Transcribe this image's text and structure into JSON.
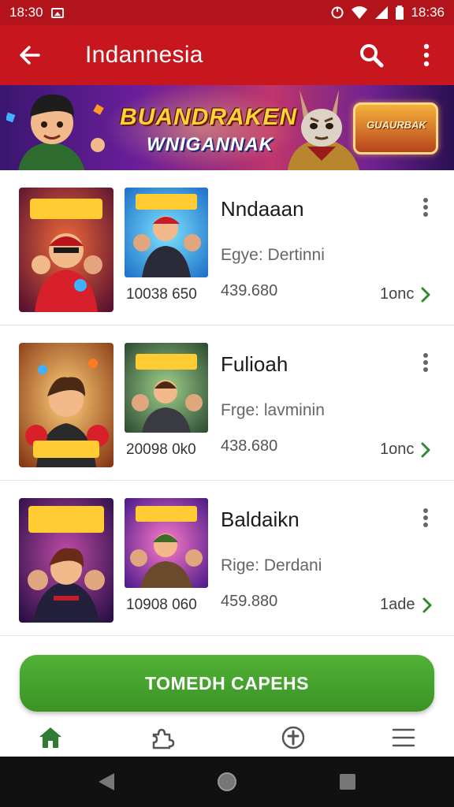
{
  "status_bar": {
    "time_left": "18:30",
    "time_right": "18:36",
    "image_icon": "image-icon",
    "icons": [
      "sync-icon",
      "wifi-icon",
      "signal-icon",
      "battery-icon"
    ]
  },
  "app_bar": {
    "title": "Indannesia",
    "back_icon": "arrow-left-icon",
    "search_icon": "search-icon",
    "menu_icon": "more-vert-icon"
  },
  "banner": {
    "line1": "BUANDRAKEN",
    "line2": "WNIGANNAK",
    "emblem_text": "GUAURBAK"
  },
  "games": [
    {
      "name": "Nndaaan",
      "genre": "Egye: Dertinni",
      "count": "439.680",
      "code": "10038 650",
      "tag": "1onc"
    },
    {
      "name": "Fulioah",
      "genre": "Frge: lavminin",
      "count": "438.680",
      "code": "20098 0k0",
      "tag": "1onc"
    },
    {
      "name": "Baldaikn",
      "genre": "Rige: Derdani",
      "count": "459.880",
      "code": "10908 060",
      "tag": "1ade"
    }
  ],
  "cta": {
    "label": "TOMEDH CAPEHS"
  },
  "bottom_nav": {
    "items": [
      "home-icon",
      "puzzle-icon",
      "compass-icon",
      "list-icon"
    ],
    "active": "home-icon"
  },
  "colors": {
    "app_bar": "#c8161f",
    "status_bar": "#b3141c",
    "accent_green": "#3a9a28",
    "nav_active": "#2e7d32"
  }
}
